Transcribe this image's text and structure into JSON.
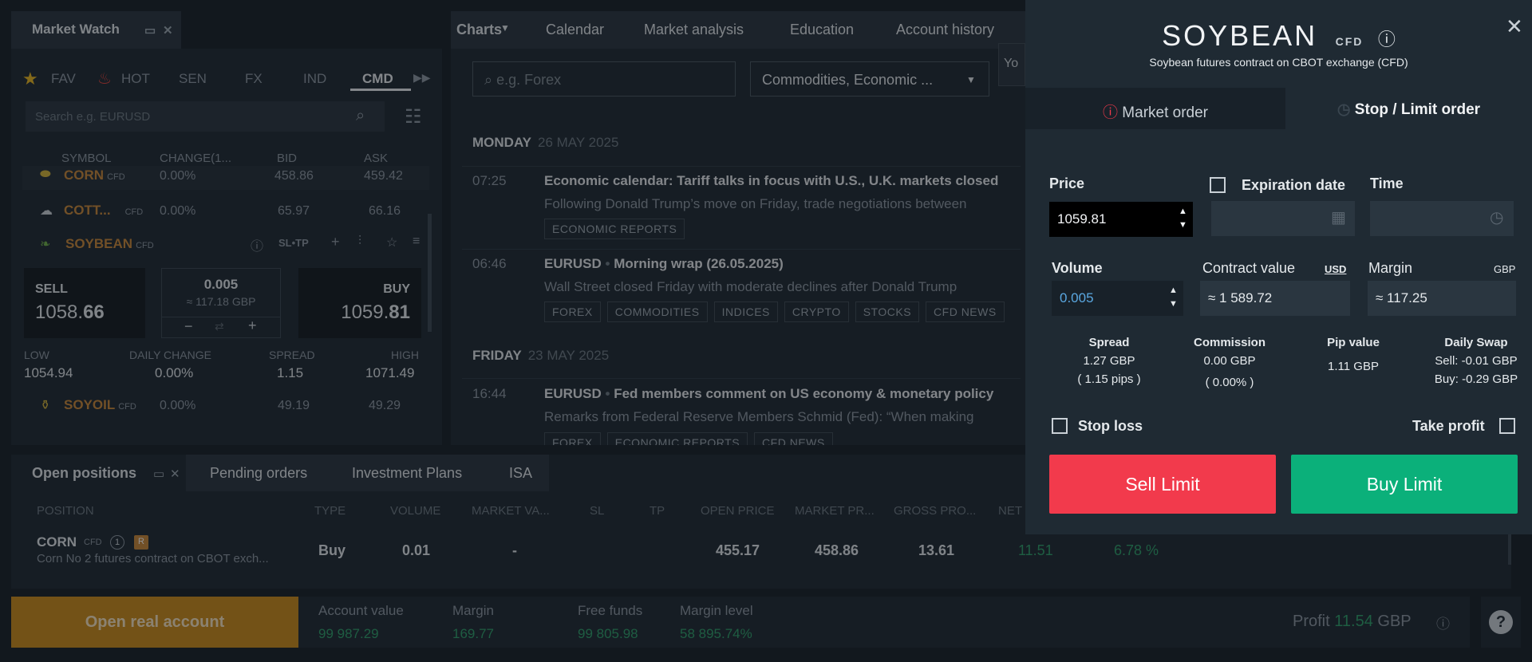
{
  "market_watch": {
    "title": "Market Watch",
    "tabs": [
      "FAV",
      "HOT",
      "SEN",
      "FX",
      "IND",
      "CMD"
    ],
    "search_placeholder": "Search e.g. EURUSD",
    "columns": [
      "SYMBOL",
      "CHANGE(1...",
      "BID",
      "ASK"
    ],
    "rows": [
      {
        "symbol": "CORN",
        "cfd": "CFD",
        "change": "0.00%",
        "bid": "458.86",
        "ask": "459.42"
      },
      {
        "symbol": "COTT...",
        "cfd": "CFD",
        "change": "0.00%",
        "bid": "65.97",
        "ask": "66.16"
      }
    ],
    "selected": {
      "symbol": "SOYBEAN",
      "cfd": "CFD",
      "sltp": "SL•TP",
      "sell_label": "SELL",
      "sell_price_a": "1058.",
      "sell_price_b": "66",
      "buy_label": "BUY",
      "buy_price_a": "1059.",
      "buy_price_b": "81",
      "volume": "0.005",
      "approx": "≈ 117.18 GBP",
      "minus": "−",
      "plus": "+",
      "low_label": "LOW",
      "low": "1054.94",
      "daily_change_label": "DAILY CHANGE",
      "daily_change": "0.00%",
      "spread_label": "SPREAD",
      "spread": "1.15",
      "high_label": "HIGH",
      "high": "1071.49"
    },
    "after": {
      "symbol": "SOYOIL",
      "cfd": "CFD",
      "change": "0.00%",
      "bid": "49.19",
      "ask": "49.29"
    }
  },
  "news": {
    "nav": [
      "Charts",
      "Calendar",
      "Market analysis",
      "Education",
      "Account history"
    ],
    "search_placeholder": "e.g. Forex",
    "filter": "Commodities, Economic ...",
    "cut": "Yo",
    "days": [
      {
        "day": "MONDAY",
        "date": "26 MAY 2025"
      },
      {
        "day": "FRIDAY",
        "date": "23 MAY 2025"
      }
    ],
    "items": [
      {
        "time": "07:25",
        "symbol": "",
        "title": "Economic calendar: Tariff talks in focus with U.S., U.K. markets closed",
        "desc": "Following Donald Trump’s move on Friday, trade negotiations between",
        "tags": [
          "ECONOMIC REPORTS"
        ]
      },
      {
        "time": "06:46",
        "symbol": "EURUSD",
        "title": "Morning wrap (26.05.2025)",
        "desc": "Wall Street closed Friday with moderate declines after Donald Trump",
        "tags": [
          "FOREX",
          "COMMODITIES",
          "INDICES",
          "CRYPTO",
          "STOCKS",
          "CFD NEWS"
        ]
      },
      {
        "time": "16:44",
        "symbol": "EURUSD",
        "title": "Fed members comment on US economy & monetary policy",
        "desc": "Remarks from Federal Reserve Members Schmid (Fed): “When making",
        "tags": [
          "FOREX",
          "ECONOMIC REPORTS",
          "CFD NEWS"
        ]
      }
    ]
  },
  "order": {
    "symbol": "SOYBEAN",
    "cfd": "CFD",
    "subtitle": "Soybean futures contract on CBOT exchange (CFD)",
    "tab_market": "Market order",
    "tab_stop": "Stop / Limit order",
    "price_label": "Price",
    "price": "1059.81",
    "expiration_label": "Expiration date",
    "time_label": "Time",
    "volume_label": "Volume",
    "volume": "0.005",
    "contract_label": "Contract value",
    "contract_ccy": "USD",
    "contract": "≈ 1 589.72",
    "margin_label": "Margin",
    "margin_ccy": "GBP",
    "margin": "≈ 117.25",
    "spread_label": "Spread",
    "spread_1": "1.27 GBP",
    "spread_2": "( 1.15 pips )",
    "commission_label": "Commission",
    "commission_1": "0.00 GBP",
    "commission_2": "( 0.00% )",
    "pip_label": "Pip value",
    "pip": "1.11 GBP",
    "swap_label": "Daily Swap",
    "swap_sell": "Sell: -0.01 GBP",
    "swap_buy": "Buy: -0.29 GBP",
    "stop_loss": "Stop loss",
    "take_profit": "Take profit",
    "sell_btn": "Sell Limit",
    "buy_btn": "Buy Limit",
    "sell_color": "#f23a4c",
    "buy_color": "#0bb07a"
  },
  "positions": {
    "tabs": [
      "Open positions",
      "Pending orders",
      "Investment Plans",
      "ISA"
    ],
    "columns": [
      "POSITION",
      "TYPE",
      "VOLUME",
      "MARKET VA...",
      "SL",
      "TP",
      "OPEN PRICE",
      "MARKET PR...",
      "GROSS PRO...",
      "NET"
    ],
    "row": {
      "symbol": "CORN",
      "cfd": "CFD",
      "count": "1",
      "badge": "R",
      "desc": "Corn No 2 futures contract on CBOT exch...",
      "type": "Buy",
      "volume": "0.01",
      "market_value": "-",
      "open_price": "455.17",
      "market_price": "458.86",
      "gross": "13.61",
      "net": "11.51",
      "pct": "6.78 %"
    }
  },
  "footer": {
    "open_real": "Open real account",
    "account_value_label": "Account value",
    "account_value": "99 987.29",
    "margin_label": "Margin",
    "margin": "169.77",
    "free_label": "Free funds",
    "free": "99 805.98",
    "level_label": "Margin level",
    "level": "58 895.74%",
    "profit_label": "Profit",
    "profit": "11.54",
    "profit_ccy": "GBP",
    "help": "?"
  }
}
